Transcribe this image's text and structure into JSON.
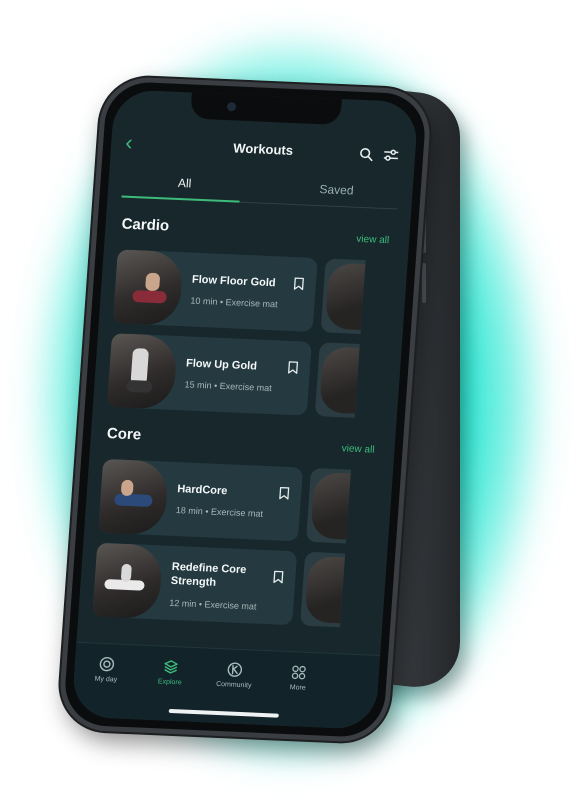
{
  "header": {
    "title": "Workouts"
  },
  "tabs": [
    {
      "label": "All"
    },
    {
      "label": "Saved"
    }
  ],
  "sections": [
    {
      "title": "Cardio",
      "view_all": "view all",
      "cards": [
        {
          "title": "Flow Floor Gold",
          "meta": "10 min • Exercise mat"
        },
        {
          "title": "Flow Up Gold",
          "meta": "15 min • Exercise mat"
        }
      ]
    },
    {
      "title": "Core",
      "view_all": "view all",
      "cards": [
        {
          "title": "HardCore",
          "meta": "18 min • Exercise mat"
        },
        {
          "title": "Redefine Core Strength",
          "meta": "12 min • Exercise mat"
        }
      ]
    }
  ],
  "bottom_nav": [
    {
      "label": "My day",
      "icon": "target-icon"
    },
    {
      "label": "Explore",
      "icon": "layers-icon"
    },
    {
      "label": "Community",
      "icon": "community-icon"
    },
    {
      "label": "More",
      "icon": "grid-icon"
    }
  ],
  "colors": {
    "accent": "#3dbb7a",
    "screen_bg": "#17272c",
    "card_bg": "#243a40",
    "glow": "#17e5cf"
  }
}
